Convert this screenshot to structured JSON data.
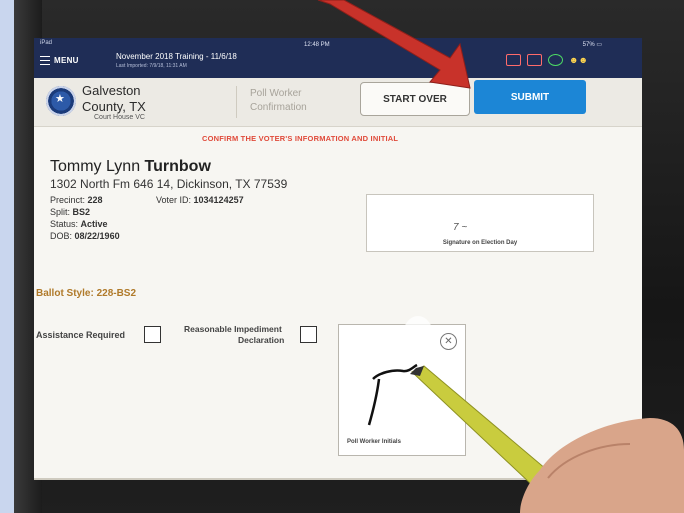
{
  "status": {
    "device": "iPad",
    "clock": "12:48 PM",
    "battery": "57%"
  },
  "topbar": {
    "menu_label": "MENU",
    "training_title": "November 2018 Training - 11/6/18",
    "last_imported": "Last Imported: 7/9/18, 11:31 AM",
    "icons": [
      "mail-icon",
      "printer-icon",
      "cloud-icon",
      "users-icon"
    ]
  },
  "header": {
    "county_line1": "Galveston",
    "county_line2": "County, TX",
    "location": "Court House VC",
    "module_line1": "Poll Worker",
    "module_line2": "Confirmation",
    "start_over_label": "START OVER",
    "submit_label": "SUBMIT"
  },
  "colors": {
    "topbar": "#1f2d56",
    "submit": "#1c86d6",
    "confirm_text": "#e04a3a",
    "ballot_style": "#b07a2a"
  },
  "confirm_message": "CONFIRM THE VOTER'S INFORMATION AND INITIAL",
  "voter": {
    "first_middle": "Tommy Lynn ",
    "last": "Turnbow",
    "address": "1302 North Fm 646 14, Dickinson, TX 77539",
    "precinct_label": "Precinct:",
    "precinct": "228",
    "voter_id_label": "Voter ID:",
    "voter_id": "1034124257",
    "split_label": "Split:",
    "split": "BS2",
    "status_label": "Status:",
    "status": "Active",
    "dob_label": "DOB:",
    "dob": "08/22/1960"
  },
  "signature": {
    "scribble": "7 ~",
    "caption": "Signature on Election Day"
  },
  "ballot_style": "Ballot Style: 228-BS2",
  "assistance_label": "Assistance Required",
  "impediment_line1": "Reasonable Impediment",
  "impediment_line2": "Declaration",
  "initials": {
    "caption": "Poll Worker Initials",
    "close_glyph": "✕"
  }
}
